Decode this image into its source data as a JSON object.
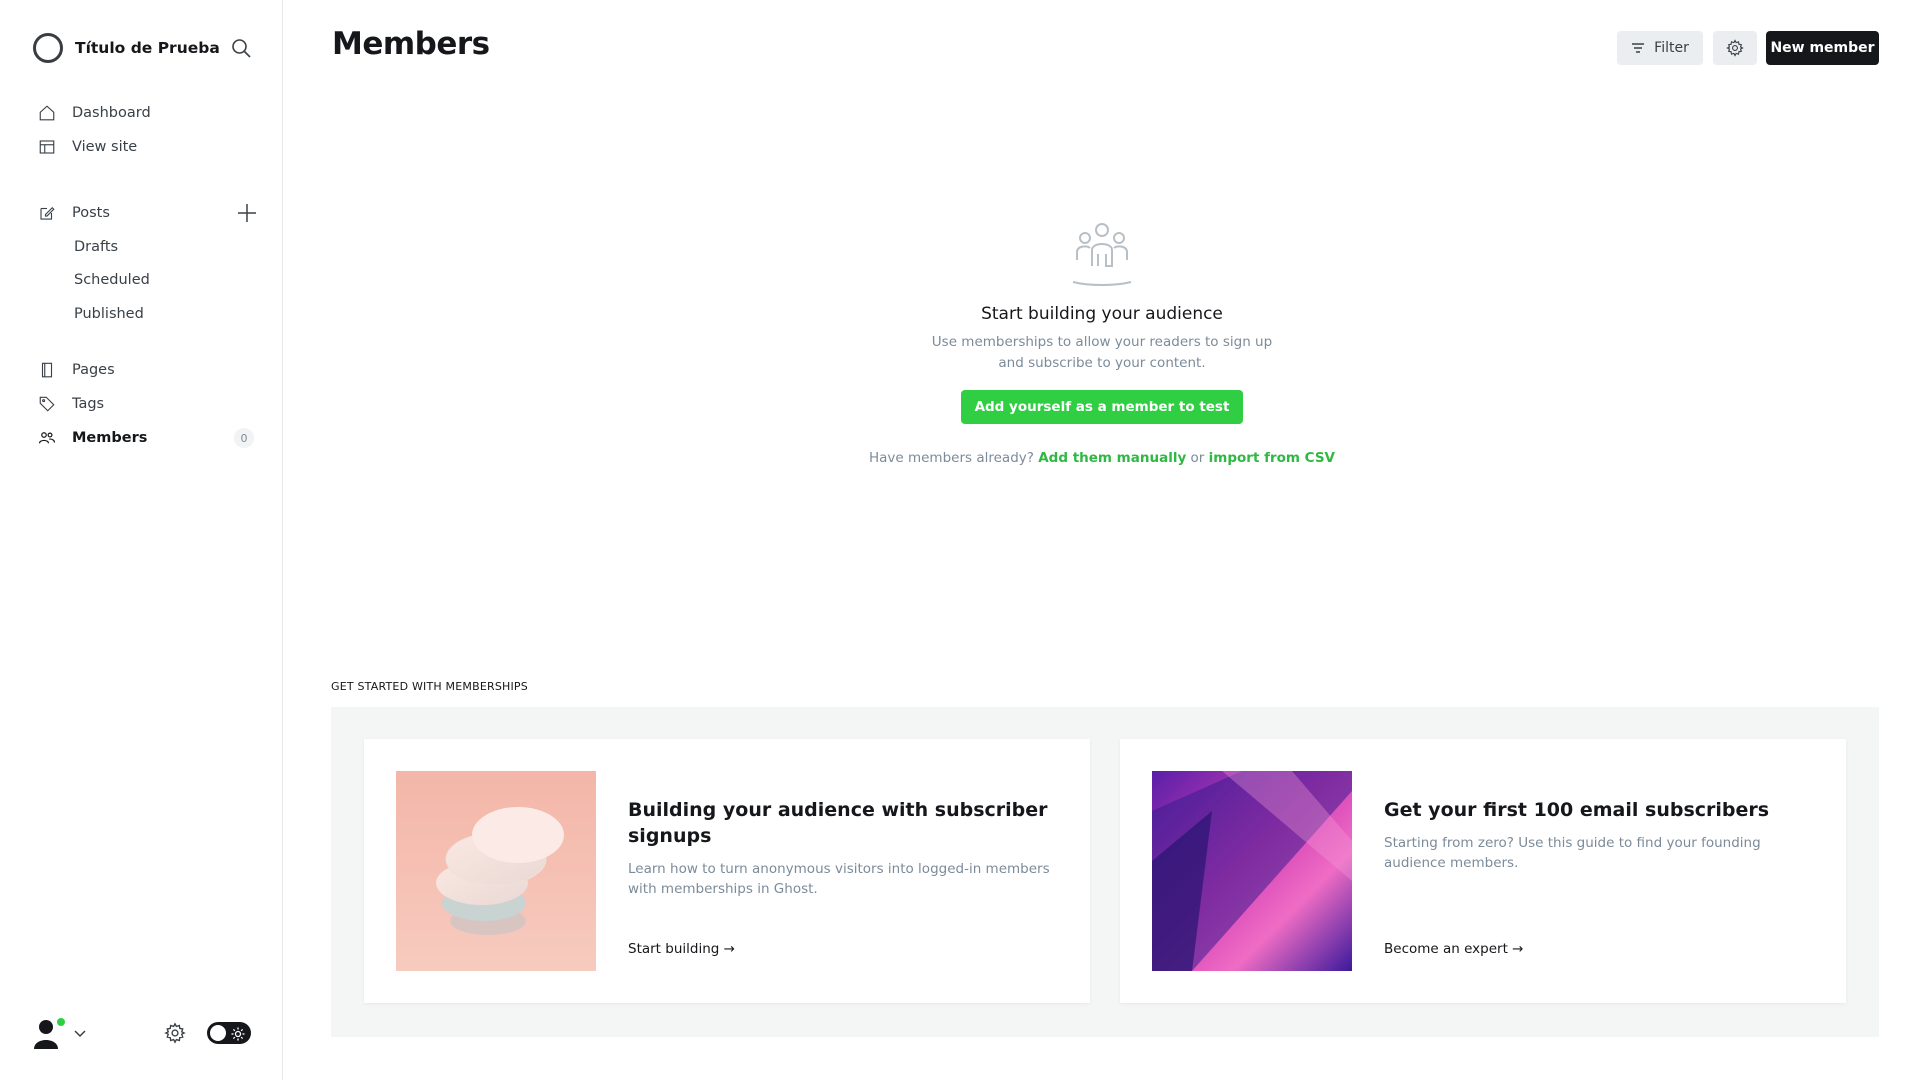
{
  "sidebar": {
    "site_title": "Título de Prueba",
    "nav": [
      {
        "label": "Dashboard",
        "icon": "home-icon"
      },
      {
        "label": "View site",
        "icon": "layout-icon"
      }
    ],
    "posts": {
      "label": "Posts",
      "icon": "edit-icon"
    },
    "post_filters": [
      "Drafts",
      "Scheduled",
      "Published"
    ],
    "pages": {
      "label": "Pages",
      "icon": "pages-icon"
    },
    "tags": {
      "label": "Tags",
      "icon": "tag-icon"
    },
    "members": {
      "label": "Members",
      "icon": "members-icon",
      "count": "0"
    }
  },
  "header": {
    "title": "Members",
    "filter_label": "Filter",
    "new_member_label": "New member"
  },
  "empty_state": {
    "title": "Start building your audience",
    "description": "Use memberships to allow your readers to sign up and subscribe to your content.",
    "cta_label": "Add yourself as a member to test",
    "prompt": "Have members already?",
    "add_manually": "Add them manually",
    "or": "or",
    "import_csv": "import from CSV"
  },
  "get_started": {
    "label": "GET STARTED WITH MEMBERSHIPS",
    "cards": [
      {
        "title": "Building your audience with subscriber signups",
        "description": "Learn how to turn anonymous visitors into logged-in members with memberships in Ghost.",
        "link": "Start building →"
      },
      {
        "title": "Get your first 100 email subscribers",
        "description": "Starting from zero? Use this guide to find your founding audience members.",
        "link": "Become an expert →"
      }
    ]
  },
  "colors": {
    "accent_green": "#30cf43",
    "primary_dark": "#15171a"
  }
}
